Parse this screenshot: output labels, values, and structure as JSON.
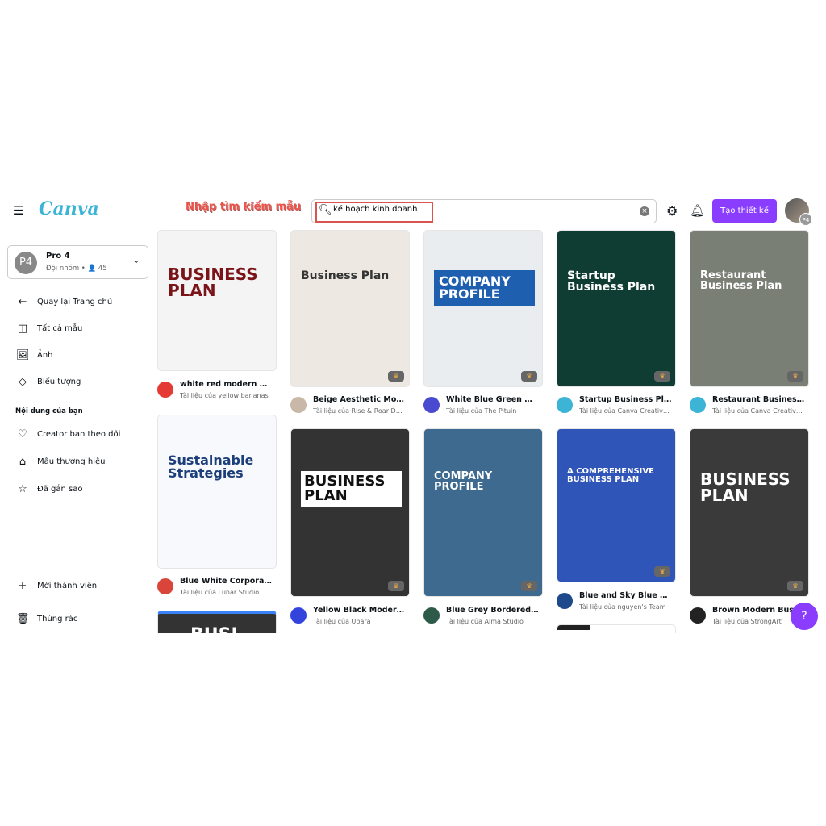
{
  "header": {
    "logo": "Canva",
    "annotation": "Nhập tìm kiếm mẫu",
    "search_value": "kế hoạch kinh doanh",
    "create_label": "Tạo thiết kế",
    "avatar_badge": "P4",
    "accent": "#8b3dff"
  },
  "sidebar": {
    "team": {
      "initials": "P4",
      "name": "Pro 4",
      "sub": "Đội nhóm • 👤 45"
    },
    "items": [
      {
        "label": "Quay lại Trang chủ",
        "icon": "←"
      },
      {
        "label": "Tất cả mẫu",
        "icon": "◫"
      },
      {
        "label": "Ảnh",
        "icon": "🖼"
      },
      {
        "label": "Biểu tượng",
        "icon": "◇"
      }
    ],
    "section": "Nội dung của bạn",
    "content_items": [
      {
        "label": "Creator bạn theo dõi",
        "icon": "♡"
      },
      {
        "label": "Mẫu thương hiệu",
        "icon": "⌂"
      },
      {
        "label": "Đã gắn sao",
        "icon": "☆"
      }
    ],
    "bottom": [
      {
        "label": "Mời thành viên",
        "icon": "+"
      },
      {
        "label": "Thùng rác",
        "icon": "🗑"
      }
    ]
  },
  "templates": [
    {
      "title": "white red modern busi...",
      "author": "Tài liệu của yellow bananas",
      "thumb_text": "BUSINESS PLAN",
      "bg": "#f4f4f4",
      "fg": "#7a1418",
      "av": "#e53935"
    },
    {
      "title": "Beige Aesthetic Moder...",
      "author": "Tài liệu của Rise & Roar Desi...",
      "thumb_text": "Business Plan",
      "bg": "#ede8e1",
      "fg": "#333",
      "av": "#c9b8a8"
    },
    {
      "title": "White Blue Green Mod...",
      "author": "Tài liệu của The Pituin",
      "thumb_text": "COMPANY PROFILE",
      "bg": "#e9edf0",
      "fg": "#fff",
      "av": "#4a4ad0"
    },
    {
      "title": "Startup Business Plan ...",
      "author": "Tài liệu của Canva Creative ...",
      "thumb_text": "Startup Business Plan",
      "bg": "#0f3d33",
      "fg": "#fff",
      "av": "#3cb4d6"
    },
    {
      "title": "Restaurant Business P...",
      "author": "Tài liệu của Canva Creative ...",
      "thumb_text": "Restaurant Business Plan",
      "bg": "#7a7f76",
      "fg": "#fff",
      "av": "#3cb4d6"
    },
    {
      "title": "Blue White Corporate ...",
      "author": "Tài liệu của Lunar Studio",
      "thumb_text": "Sustainable Strategies",
      "bg": "#f7f9fc",
      "fg": "#1c3f7a",
      "av": "#d9453a"
    },
    {
      "title": "Yellow Black Modern B...",
      "author": "Tài liệu của Ubara",
      "thumb_text": "BUSINESS PLAN",
      "bg": "#333",
      "fg": "#111",
      "av": "#3344dd"
    },
    {
      "title": "Blue Grey Bordered St...",
      "author": "Tài liệu của Alma Studio",
      "thumb_text": "COMPANY PROFILE",
      "bg": "#3d6a8e",
      "fg": "#fff",
      "av": "#2e5a4a"
    },
    {
      "title": "Blue and Sky Blue Geo...",
      "author": "Tài liệu của nguyen's Team",
      "thumb_text": "A COMPREHENSIVE BUSINESS PLAN",
      "bg": "#2f55b8",
      "fg": "#fff",
      "av": "#1e4a8c"
    },
    {
      "title": "Brown Modern Busin...",
      "author": "Tài liệu của StrongArt",
      "thumb_text": "BUSINESS PLAN",
      "bg": "#3a3a3a",
      "fg": "#fff",
      "av": "#222"
    }
  ],
  "partial_thumb_text": "BUSI",
  "help_label": "?"
}
